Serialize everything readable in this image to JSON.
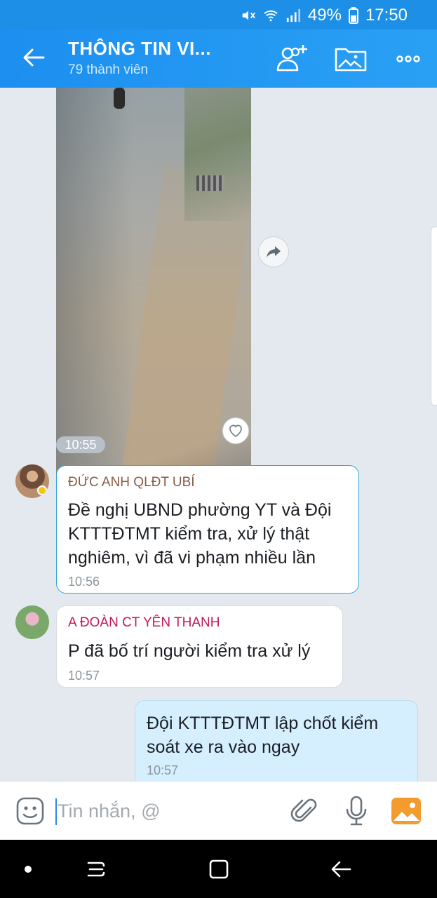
{
  "status_bar": {
    "battery": "49%",
    "time": "17:50"
  },
  "header": {
    "title": "THÔNG TIN VI...",
    "member_count": "79 thành viên"
  },
  "messages": [
    {
      "type": "image",
      "time": "10:55"
    },
    {
      "type": "text",
      "sender": "ĐỨC ANH QLĐT UBÍ",
      "sender_color": "#8a5a44",
      "lines": [
        "Đề nghị UBND phường YT và Đội",
        "KTTTĐTMT kiểm tra, xử lý thật",
        "nghiêm, vì đã vi phạm nhiều lần"
      ],
      "time": "10:56"
    },
    {
      "type": "text",
      "sender": "A ĐOÀN CT YÊN THANH",
      "sender_color": "#c2185b",
      "lines": [
        "P đã bố trí người kiểm tra xử lý"
      ],
      "time": "10:57"
    },
    {
      "type": "text",
      "outgoing": true,
      "lines": [
        "Đội KTTTĐTMT lập chốt kiểm",
        "soát xe ra vào ngay"
      ],
      "time": "10:57"
    }
  ],
  "input": {
    "placeholder": "Tin nhắn, @"
  },
  "colors": {
    "header": "#1c8ff0",
    "outgoing_bubble": "#d5efff",
    "chat_background": "#e3e9ef",
    "accent": "#2b8de6"
  },
  "icons": [
    "back-arrow-icon",
    "add-member-icon",
    "gallery-icon",
    "more-icon",
    "share-icon",
    "heart-icon",
    "sticker-icon",
    "paperclip-icon",
    "microphone-icon",
    "image-icon",
    "nav-dot-icon",
    "recents-icon",
    "home-icon",
    "nav-back-icon"
  ]
}
